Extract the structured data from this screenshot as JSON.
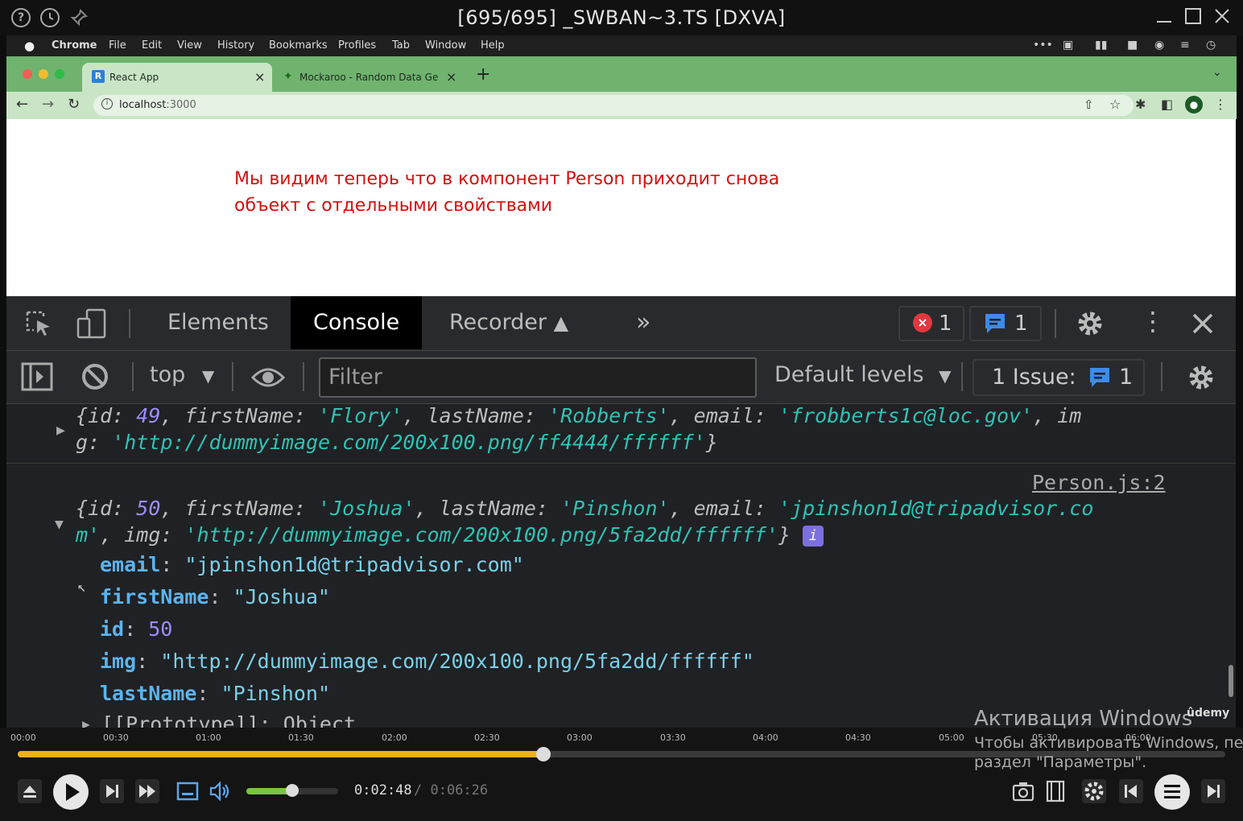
{
  "player": {
    "title": "[695/695] _SWBAN~3.TS [DXVA]",
    "help_icon": "?",
    "timeline": [
      "00:00",
      "00:30",
      "01:00",
      "01:30",
      "02:00",
      "02:30",
      "03:00",
      "03:30",
      "04:00",
      "04:30",
      "05:00",
      "05:30",
      "06:00"
    ],
    "progress": 0.435,
    "volume": 0.5,
    "time_current": "0:02:48",
    "time_separator": "/",
    "time_total": "0:06:26",
    "udemy": "ûdemy"
  },
  "macmenu": {
    "items": [
      "Chrome",
      "File",
      "Edit",
      "View",
      "History",
      "Bookmarks",
      "Profiles",
      "Tab",
      "Window",
      "Help"
    ],
    "status": [
      "•••"
    ]
  },
  "browser": {
    "tabs": [
      {
        "label": "React App",
        "favicon": "R"
      },
      {
        "label": "Mockaroo - Random Data Gene"
      }
    ],
    "new_tab": "+",
    "url_host": "localhost",
    "url_port": ":3000"
  },
  "page": {
    "note_line1": "Мы видим теперь что в компонент Person приходит снова",
    "note_line2": "объект с отдельными свойствами"
  },
  "devtools": {
    "tabs": [
      "Elements",
      "Console",
      "Recorder"
    ],
    "more": "»",
    "errors_count": "1",
    "messages_count": "1",
    "context": "top",
    "filter_placeholder": "Filter",
    "levels": "Default levels",
    "issues_label": "1 Issue:",
    "issues_count": "1"
  },
  "console": {
    "entry1": {
      "id": "49",
      "firstName": "'Flory'",
      "lastName": "'Robberts'",
      "email": "'frobberts1c@loc.gov'",
      "img_key_a": "im",
      "img_key_b": "g",
      "img": "'http://dummyimage.com/200x100.png/ff4444/ffffff'"
    },
    "source": "Person.js:2",
    "entry2": {
      "id": "50",
      "firstName": "'Joshua'",
      "lastName": "'Pinshon'",
      "email_a": "'jpinshon1d@tripadvisor.co",
      "email_b": "m'",
      "img": "'http://dummyimage.com/200x100.png/5fa2dd/ffffff'",
      "info_badge": "i",
      "props": [
        {
          "key": "email",
          "value": "\"jpinshon1d@tripadvisor.com\""
        },
        {
          "key": "firstName",
          "value": "\"Joshua\""
        },
        {
          "key": "id",
          "value": "50"
        },
        {
          "key": "img",
          "value": "\"http://dummyimage.com/200x100.png/5fa2dd/ffffff\""
        },
        {
          "key": "lastName",
          "value": "\"Pinshon\""
        }
      ],
      "prototype": "[[Prototype]]: Object"
    }
  },
  "watermark": {
    "line1": "Активация Windows",
    "line2": "Чтобы активировать Windows, пе",
    "line3": "раздел \"Параметры\"."
  }
}
